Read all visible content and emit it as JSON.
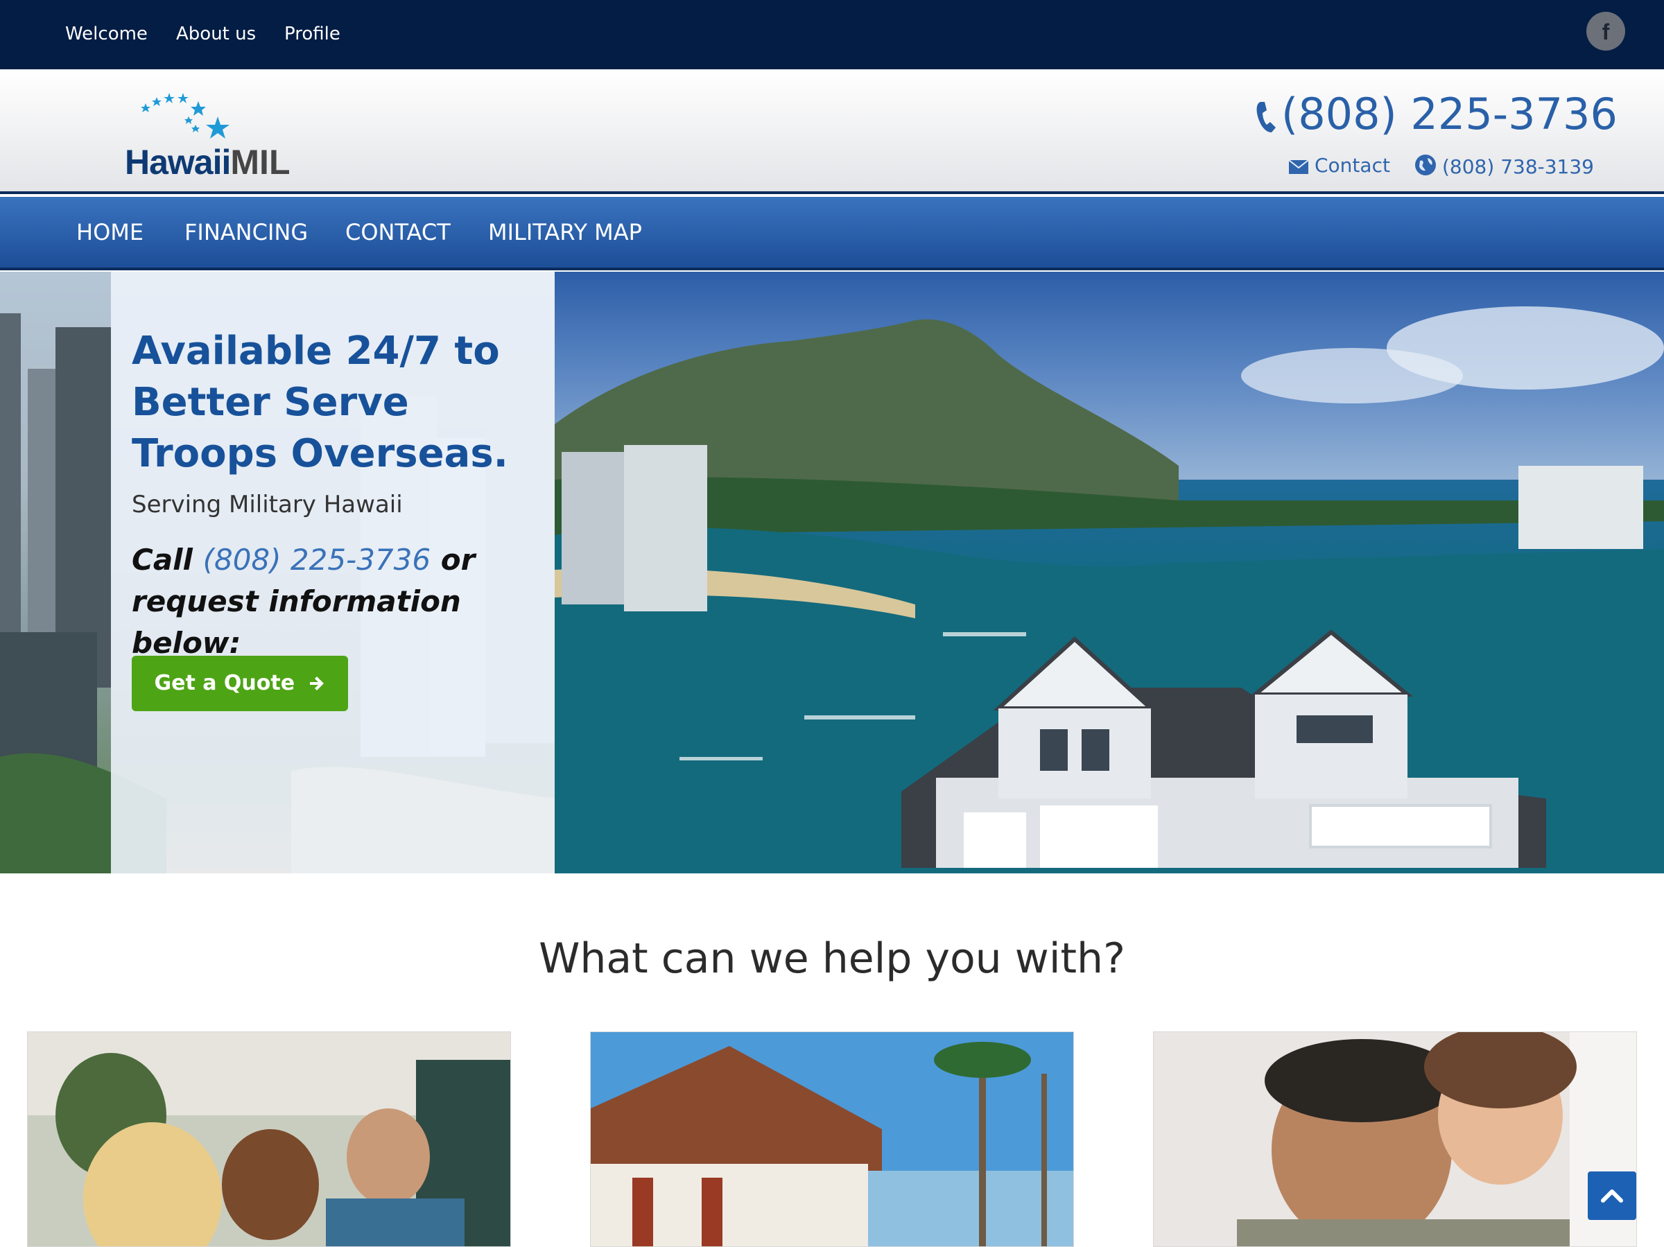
{
  "topbar": {
    "links": [
      "Welcome",
      "About us",
      "Profile"
    ],
    "social_icon": "facebook-icon"
  },
  "header": {
    "logo_word_hawaii": "Hawaii",
    "logo_word_mil": "MIL",
    "phone_main": "(808) 225-3736",
    "contact_label": "Contact",
    "phone_secondary": "(808) 738-3139"
  },
  "mainnav": {
    "items": [
      "HOME",
      "FINANCING",
      "CONTACT",
      "MILITARY MAP"
    ]
  },
  "hero": {
    "title": "Available 24/7 to Better Serve Troops Overseas.",
    "subtitle": "Serving Military Hawaii",
    "call_prefix": "Call ",
    "call_phone": "(808) 225-3736",
    "call_suffix": " or request information below:",
    "cta_label": "Get a Quote"
  },
  "help_section": {
    "title": "What can we help you with?"
  },
  "colors": {
    "topbar": "#031d44",
    "nav_blue": "#2960a8",
    "cta_green": "#4da415",
    "title_blue": "#17519a"
  }
}
